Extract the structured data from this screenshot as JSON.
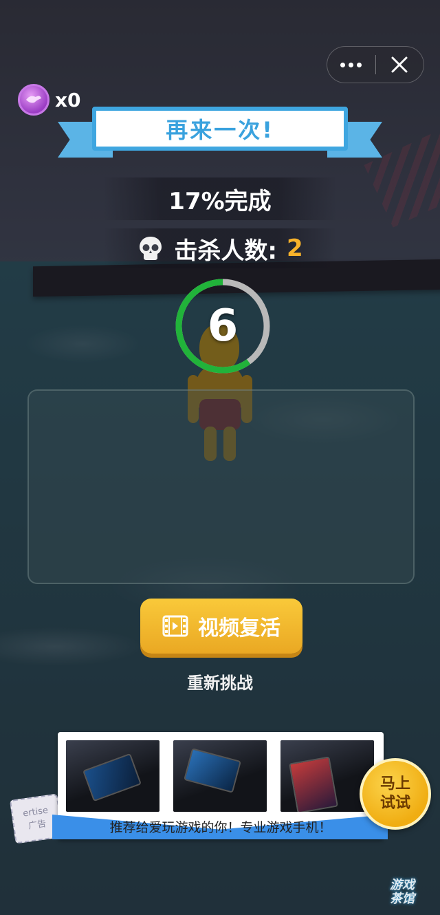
{
  "top_bar": {
    "coin_count": "x0"
  },
  "banner": {
    "title": "再来一次!"
  },
  "progress": {
    "percent_text": "17%完成",
    "percent_value": 17
  },
  "kills": {
    "label": "击杀人数:",
    "count": "2",
    "count_color": "#f7b22b"
  },
  "countdown": {
    "seconds": "6",
    "ring_fraction_remaining": 0.6,
    "ring_active_color": "#21b33a",
    "ring_track_color": "#b9b9b9"
  },
  "actions": {
    "revive_label": "视频复活",
    "retry_label": "重新挑战"
  },
  "ad": {
    "caption": "推荐给爱玩游戏的你！专业游戏手机！",
    "try_label": "马上试试",
    "stamp_text_top": "ertise",
    "stamp_text_bottom": "广告",
    "watermark_line1": "游戏",
    "watermark_line2": "茶馆"
  },
  "icons": [
    "coin-icon",
    "more-dots-icon",
    "close-icon",
    "skull-icon",
    "video-icon"
  ],
  "colors": {
    "accent_yellow": "#f9c93a",
    "banner_blue": "#3fa6e0",
    "ad_blue": "#3a8fe8"
  }
}
